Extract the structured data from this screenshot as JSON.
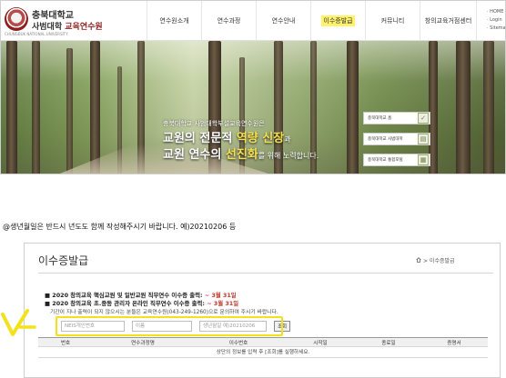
{
  "header": {
    "logo_line1": "충북대학교",
    "logo_line2_black": "사범대학",
    "logo_line2_red": "교육연수원",
    "logo_sub": "CHUNGBUK NATIONAL UNIVERSITY",
    "nav": [
      {
        "label": "연수원소개",
        "active": false
      },
      {
        "label": "연수과정",
        "active": false
      },
      {
        "label": "연수안내",
        "active": false
      },
      {
        "label": "이수증발급",
        "active": true
      },
      {
        "label": "커뮤니티",
        "active": false
      },
      {
        "label": "창의교육거점센터",
        "active": false
      }
    ],
    "util_links": [
      "· HOME",
      "· Login",
      "· Sitemap"
    ]
  },
  "hero": {
    "intro": "충북대학교 사범대학부설교육연수원은",
    "line1_a": "교원의 전문적 ",
    "line1_hl": "역량 신장",
    "line1_b": "과",
    "line2_a": "교원 연수의 ",
    "line2_hl": "선진화",
    "line2_b": "를 위해 노력합니다.",
    "quick_links": [
      "충북대학교 홈",
      "충북대학교 사범대학",
      "충북대학교 통합포털"
    ],
    "colors": {
      "highlight": "#f6e04b",
      "brand_red": "#8d1f1f"
    }
  },
  "note": {
    "text": "@생년월일은 반드시 년도도 함께 작성해주시기 바랍니다. 예)20210206 등"
  },
  "certificate": {
    "title": "이수증발급",
    "breadcrumb": "> 이수증발급",
    "notices": [
      {
        "prefix": "■ 2020 창의교육 핵심교원 및 일반교원 직무연수 이수증 출력: ",
        "deadline": "~ 3월 31일"
      },
      {
        "prefix": "■ 2020 창의교육 초.중등 관리자 온라인 직무연수 이수증 출력: ",
        "deadline": "~ 3월 31일"
      }
    ],
    "notice_sub": "기간이 지나 출력이 되지 않으시는 분들은 교육연수원(043-249-1260)으로 문의하여 주시기 바랍니다.",
    "search": {
      "neis_placeholder": "NEIS개인번호",
      "name_placeholder": "이름",
      "birth_placeholder": "생년월일 예)20210206",
      "button_label": "조회"
    },
    "table": {
      "headers": [
        "번호",
        "연수과정명",
        "이수번호",
        "시작일",
        "종료일",
        "증명서"
      ],
      "empty_message": "상단의 정보를 입력 후 [조회]를 실행하세요."
    },
    "annotation_color": "#f3e21a"
  }
}
